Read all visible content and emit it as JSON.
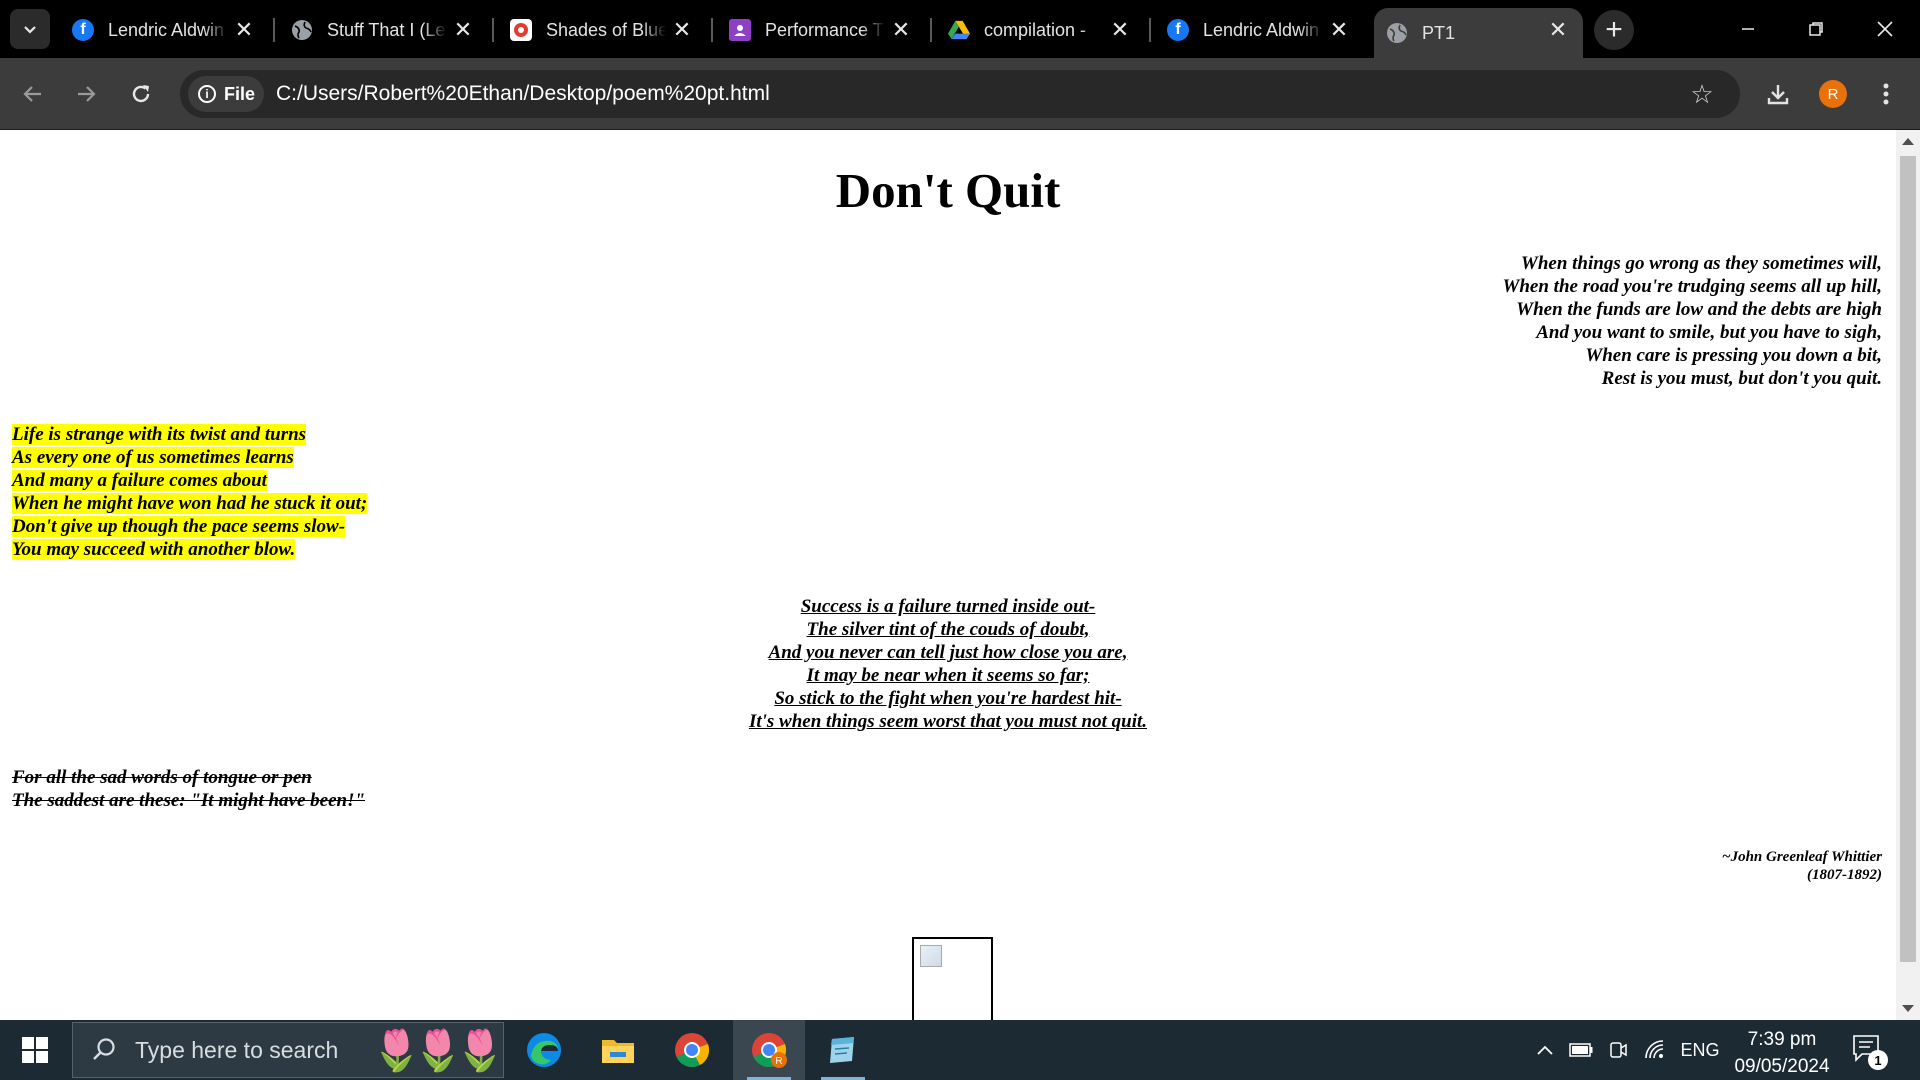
{
  "browser": {
    "tabs": [
      {
        "title": "Lendric Aldwin",
        "icon": "facebook-icon",
        "color": "#1877f2",
        "glyph": "f"
      },
      {
        "title": "Stuff That I (Le",
        "icon": "globe-icon",
        "color": "#9aa0a6",
        "glyph": ""
      },
      {
        "title": "Shades of Blue",
        "icon": "record-icon",
        "color": "#e33b2e",
        "glyph": ""
      },
      {
        "title": "Performance T",
        "icon": "classroom-icon",
        "color": "#8e3fc4",
        "glyph": ""
      },
      {
        "title": "compilation -",
        "icon": "google-drive-icon",
        "color": "#34a853",
        "glyph": ""
      },
      {
        "title": "Lendric Aldwin",
        "icon": "facebook-icon",
        "color": "#1877f2",
        "glyph": "f"
      },
      {
        "title": "PT1",
        "icon": "globe-icon",
        "color": "#9aa0a6",
        "glyph": ""
      }
    ],
    "address": {
      "chip_label": "File",
      "url": "C:/Users/Robert%20Ethan/Desktop/poem%20pt.html"
    },
    "profile_initial": "R",
    "accent": "#e8710a"
  },
  "page": {
    "title": "Don't Quit",
    "stanza1": [
      "When things go wrong as they sometimes will,",
      "When the road you're trudging seems all up hill,",
      "When the funds are low and the debts are high",
      "And you want to smile, but you have to sigh,",
      "When care is pressing you down a bit,",
      "Rest is you must, but don't you quit."
    ],
    "stanza2": [
      "Life is strange with its twist and turns",
      "As every one of us sometimes learns",
      "And many a failure comes about",
      "When he might have won had he stuck it out;",
      "Don't give up though the pace seems slow-",
      "You may succeed with another blow."
    ],
    "stanza3": [
      "Success is a failure turned inside out-",
      "The silver tint of the couds of doubt,",
      "And you never can tell just how close you are,",
      "It may be near when it seems so far;",
      "So stick to the fight when you're hardest hit-",
      "It's when things seem worst that you must not quit."
    ],
    "stanza4": [
      "For all the sad words of tongue or pen",
      "The saddest are these: \"It might have been!\""
    ],
    "credit_name": "~John Greenleaf Whittier",
    "credit_years": "(1807-1892)",
    "highlight_color": "#ffff00"
  },
  "taskbar": {
    "search_placeholder": "Type here to search",
    "language": "ENG",
    "time": "7:39 pm",
    "date": "09/05/2024",
    "notification_count": "1",
    "apps": [
      "edge-icon",
      "file-explorer-icon",
      "chrome-icon",
      "chrome-profile-icon",
      "notepad-icon"
    ]
  }
}
